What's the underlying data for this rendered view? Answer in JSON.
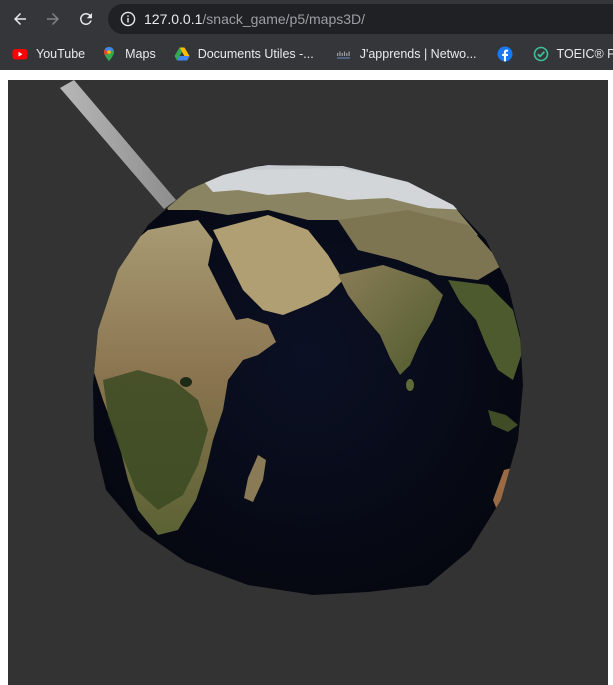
{
  "browser": {
    "url_host": "127.0.0.1",
    "url_path": "/snack_game/p5/maps3D/"
  },
  "bookmarks": [
    {
      "label": "YouTube",
      "icon": "youtube-icon"
    },
    {
      "label": "Maps",
      "icon": "google-maps-icon"
    },
    {
      "label": "Documents Utiles -...",
      "icon": "google-drive-icon"
    },
    {
      "label": "J'apprends | Netwo...",
      "icon": "cisco-icon"
    },
    {
      "label": "",
      "icon": "facebook-icon"
    },
    {
      "label": "TOEIC® Prep- A",
      "icon": "toeic-check-icon"
    }
  ],
  "colors": {
    "toolbar_bg": "#35363a",
    "omnibox_bg": "#202124",
    "canvas_bg": "#333333",
    "ocean": "#080c1c",
    "land": "#8a7a55",
    "vegetation": "#3a4a22",
    "ice": "#d8dde2",
    "rod": "#a8a8a8"
  },
  "canvas": {
    "content": "3D rotating textured earth globe rendered with p5.js"
  }
}
